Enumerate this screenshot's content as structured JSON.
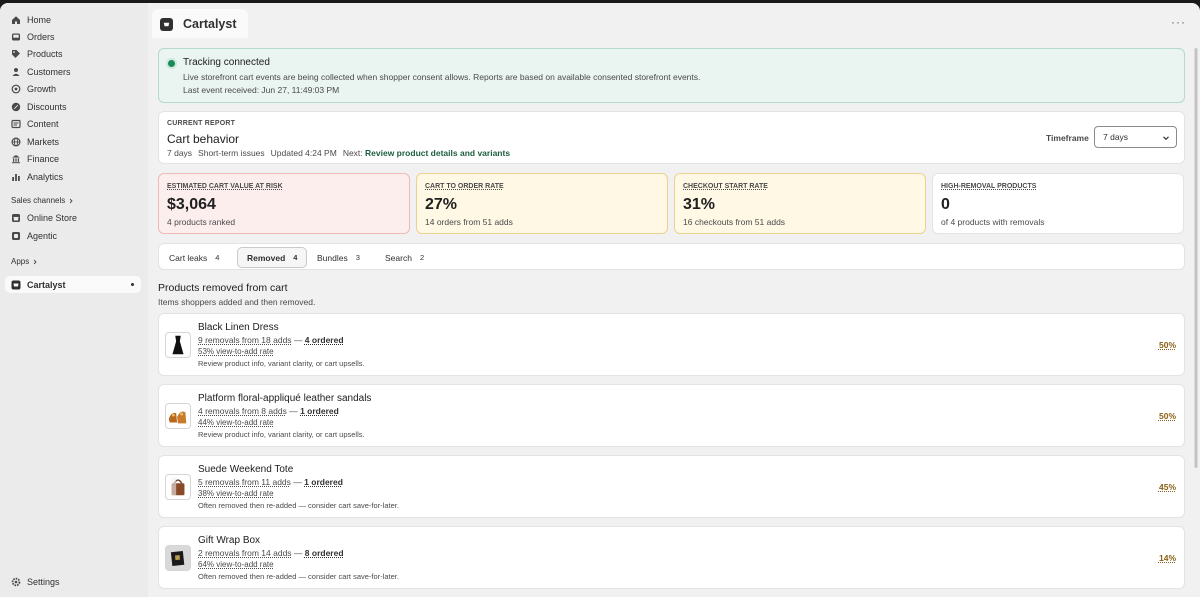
{
  "sidebar": {
    "items": [
      {
        "label": "Home",
        "icon": "home-icon"
      },
      {
        "label": "Orders",
        "icon": "inbox-icon"
      },
      {
        "label": "Products",
        "icon": "tag-icon"
      },
      {
        "label": "Customers",
        "icon": "person-icon"
      },
      {
        "label": "Growth",
        "icon": "target-icon"
      },
      {
        "label": "Discounts",
        "icon": "discount-icon"
      },
      {
        "label": "Content",
        "icon": "content-icon"
      },
      {
        "label": "Markets",
        "icon": "globe-icon"
      },
      {
        "label": "Finance",
        "icon": "bank-icon"
      },
      {
        "label": "Analytics",
        "icon": "bar-chart-icon"
      }
    ],
    "sales_channels_label": "Sales channels",
    "channels": [
      {
        "label": "Online Store",
        "icon": "store-icon"
      },
      {
        "label": "Agentic",
        "icon": "agent-icon"
      }
    ],
    "apps_label": "Apps",
    "active_app": "Cartalyst",
    "settings_label": "Settings"
  },
  "appbar": {
    "title": "Cartalyst",
    "more": "···"
  },
  "banner": {
    "title": "Tracking connected",
    "line1": "Live storefront cart events are being collected when shopper consent allows. Reports are based on available consented storefront events.",
    "line2": "Last event received: Jun 27, 11:49:03 PM",
    "status_color": "#1a8a5a"
  },
  "report": {
    "label": "CURRENT REPORT",
    "title": "Cart behavior",
    "days": "7 days",
    "scope": "Short-term issues",
    "updated": "Updated 4:24 PM",
    "next_prefix": "Next:",
    "next_action": "Review product details and variants",
    "timeframe_label": "Timeframe",
    "timeframe_value": "7 days"
  },
  "metrics": [
    {
      "label": "ESTIMATED CART VALUE AT RISK",
      "value": "$3,064",
      "sub": "4 products ranked"
    },
    {
      "label": "CART TO ORDER RATE",
      "value": "27%",
      "sub": "14 orders from 51 adds"
    },
    {
      "label": "CHECKOUT START RATE",
      "value": "31%",
      "sub": "16 checkouts from 51 adds"
    },
    {
      "label": "HIGH-REMOVAL PRODUCTS",
      "value": "0",
      "sub": "of 4 products with removals"
    }
  ],
  "tabs": [
    {
      "label": "Cart leaks",
      "count": "4"
    },
    {
      "label": "Removed",
      "count": "4"
    },
    {
      "label": "Bundles",
      "count": "3"
    },
    {
      "label": "Search",
      "count": "2"
    }
  ],
  "list": {
    "title": "Products removed from cart",
    "subtitle": "Items shoppers added and then removed."
  },
  "products": [
    {
      "name": "Black Linen Dress",
      "removals": "9 removals from 18 adds",
      "sep": "—",
      "ordered": "4 ordered",
      "rate": "53% view-to-add rate",
      "note": "Review product info, variant clarity, or cart upsells.",
      "pct": "50%"
    },
    {
      "name": "Platform floral-appliqué leather sandals",
      "removals": "4 removals from 8 adds",
      "sep": "—",
      "ordered": "1 ordered",
      "rate": "44% view-to-add rate",
      "note": "Review product info, variant clarity, or cart upsells.",
      "pct": "50%"
    },
    {
      "name": "Suede Weekend Tote",
      "removals": "5 removals from 11 adds",
      "sep": "—",
      "ordered": "1 ordered",
      "rate": "38% view-to-add rate",
      "note": "Often removed then re-added — consider cart save-for-later.",
      "pct": "45%"
    },
    {
      "name": "Gift Wrap Box",
      "removals": "2 removals from 14 adds",
      "sep": "—",
      "ordered": "8 ordered",
      "rate": "64% view-to-add rate",
      "note": "Often removed then re-added — consider cart save-for-later.",
      "pct": "14%"
    }
  ]
}
